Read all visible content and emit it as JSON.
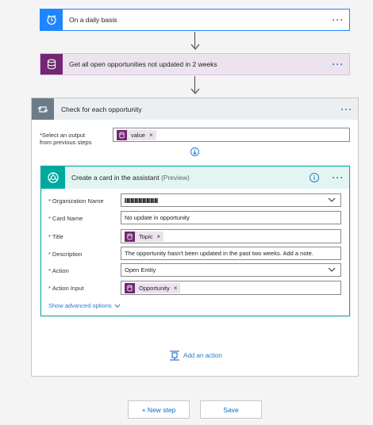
{
  "steps": {
    "trigger": {
      "title": "On a daily basis",
      "color": "#1f85ff"
    },
    "query": {
      "title": "Get all open opportunities not updated in 2 weeks",
      "color": "#742774",
      "bg": "#ece3ef"
    },
    "loop": {
      "title": "Check for each opportunity",
      "color": "#6c7b88",
      "select_label_1": "Select an output",
      "select_label_2": "from previous steps",
      "select_token": "value"
    },
    "action": {
      "title": "Create a card in the assistant",
      "preview": "(Preview)",
      "color": "#00a99d",
      "fields": {
        "org_name": {
          "label": "Organization Name",
          "value": ""
        },
        "card_name": {
          "label": "Card Name",
          "value": "No update in opportunity"
        },
        "title": {
          "label": "Title",
          "token": "Topic"
        },
        "description": {
          "label": "Description",
          "value": "The opportunity hasn't been updated in the past two weeks. Add a note."
        },
        "action": {
          "label": "Action",
          "value": "Open Entity"
        },
        "action_input": {
          "label": "Action Input",
          "token": "Opportunity"
        }
      },
      "advanced": "Show advanced options"
    },
    "add_action": "Add an action"
  },
  "buttons": {
    "new_step": "+ New step",
    "save": "Save"
  },
  "icons": {
    "trigger": "alarm-clock-icon",
    "query": "database-icon",
    "loop": "loop-icon",
    "action": "assistant-icon",
    "info": "info-icon",
    "more": "more-dots-icon",
    "chevron": "chevron-down-icon",
    "add_action": "add-action-icon"
  }
}
